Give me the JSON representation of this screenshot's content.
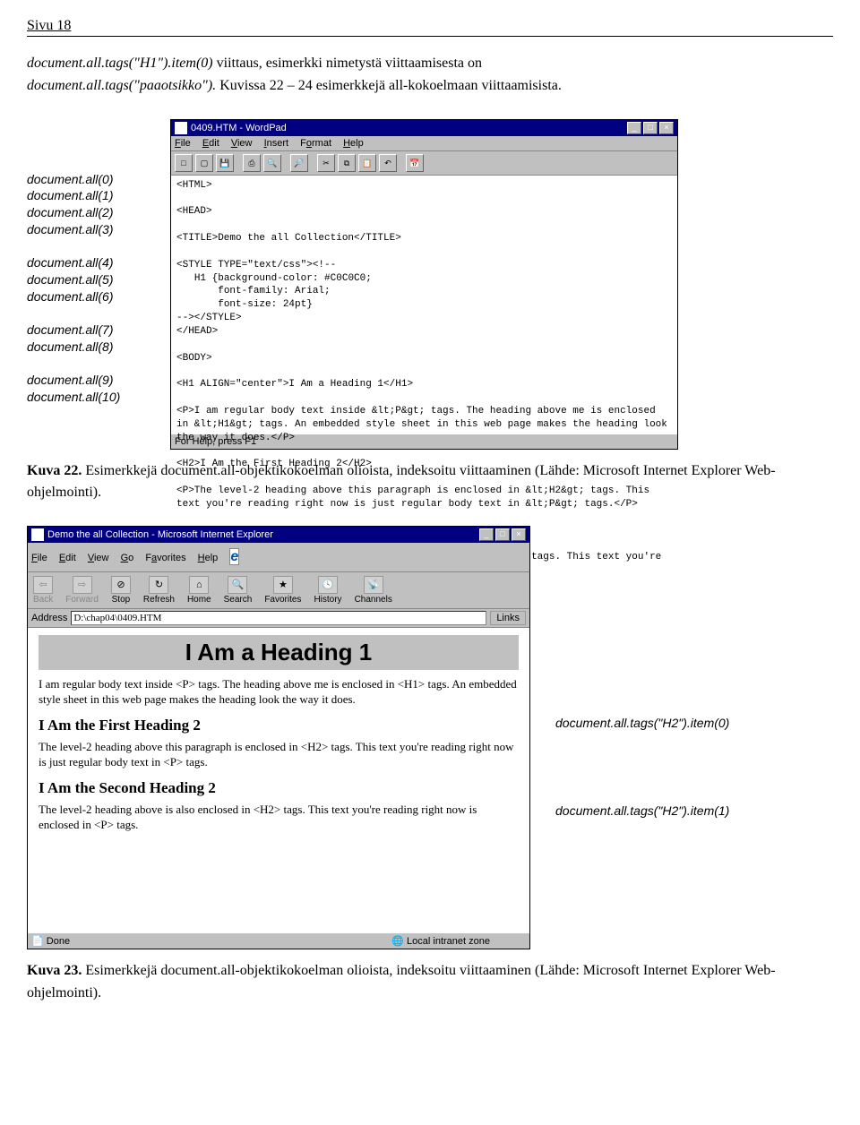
{
  "page_header": "Sivu 18",
  "intro_1_a": "document.all.tags(\"H1\").item(0)",
  "intro_1_b": " viittaus, esimerkki nimetystä viittaamisesta on",
  "intro_2_a": "document.all.tags(\"paaotsikko\").",
  "intro_2_b": " Kuvissa 22 – 24 esimerkkejä all-kokoelmaan viittaamisista.",
  "labels": {
    "g1": [
      "document.all(0)",
      "document.all(1)",
      "document.all(2)",
      "document.all(3)"
    ],
    "g2": [
      "document.all(4)",
      "document.all(5)",
      "document.all(6)"
    ],
    "g3": [
      "document.all(7)",
      "document.all(8)"
    ],
    "g4": [
      "document.all(9)",
      "document.all(10)"
    ]
  },
  "wordpad": {
    "title": "0409.HTM - WordPad",
    "menu": [
      "File",
      "Edit",
      "View",
      "Insert",
      "Format",
      "Help"
    ],
    "code": "<HTML>\n\n<HEAD>\n\n<TITLE>Demo the all Collection</TITLE>\n\n<STYLE TYPE=\"text/css\"><!--\n   H1 {background-color: #C0C0C0;\n       font-family: Arial;\n       font-size: 24pt}\n--></STYLE>\n</HEAD>\n\n<BODY>\n\n<H1 ALIGN=\"center\">I Am a Heading 1</H1>\n\n<P>I am regular body text inside &lt;P&gt; tags. The heading above me is enclosed in &lt;H1&gt; tags. An embedded style sheet in this web page makes the heading look the way it does.</P>\n\n<H2>I Am the First Heading 2</H2>\n\n<P>The level-2 heading above this paragraph is enclosed in &lt;H2&gt; tags. This text you're reading right now is just regular body text in &lt;P&gt; tags.</P>\n\n<H2>I Am the Second Heading 2</H2>\n\n<P>The level-2 heading above is also enclosed in &lt;H2&gt; tags. This text you're reading right now is enclosed in &lt;P&gt; tags.</P>\n</BODY>\n</HTML>",
    "status": "For Help, press F1"
  },
  "caption22_b": "Kuva 22.",
  "caption22_t": " Esimerkkejä document.all-objektikokoelman olioista, indeksoitu viittaaminen (Lähde: Microsoft Internet Explorer Web-ohjelmointi).",
  "ie": {
    "title": "Demo the all Collection - Microsoft Internet Explorer",
    "menu": [
      "File",
      "Edit",
      "View",
      "Go",
      "Favorites",
      "Help"
    ],
    "toolbar": [
      "Back",
      "Forward",
      "Stop",
      "Refresh",
      "Home",
      "Search",
      "Favorites",
      "History",
      "Channels"
    ],
    "addr_label": "Address",
    "addr_value": "D:\\chap04\\0409.HTM",
    "links": "Links",
    "h1": "I Am a Heading 1",
    "p1": "I am regular body text inside <P> tags. The heading above me is enclosed in <H1> tags. An embedded style sheet in this web page makes the heading look the way it does.",
    "h2a": "I Am the First Heading 2",
    "p2": "The level-2 heading above this paragraph is enclosed in <H2> tags. This text you're reading right now is just regular body text in <P> tags.",
    "h2b": "I Am the Second Heading 2",
    "p3": "The level-2 heading above is also enclosed in <H2> tags. This text you're reading right now is enclosed in <P> tags.",
    "status_left": "Done",
    "status_right": "Local intranet zone"
  },
  "annot": {
    "a1": "document.all.tags(\"H2\").item(0)",
    "a2": "document.all.tags(\"H2\").item(1)"
  },
  "caption23_b": "Kuva 23.",
  "caption23_t": " Esimerkkejä document.all-objektikokoelman olioista, indeksoitu viittaaminen (Lähde: Microsoft Internet Explorer Web-ohjelmointi)."
}
